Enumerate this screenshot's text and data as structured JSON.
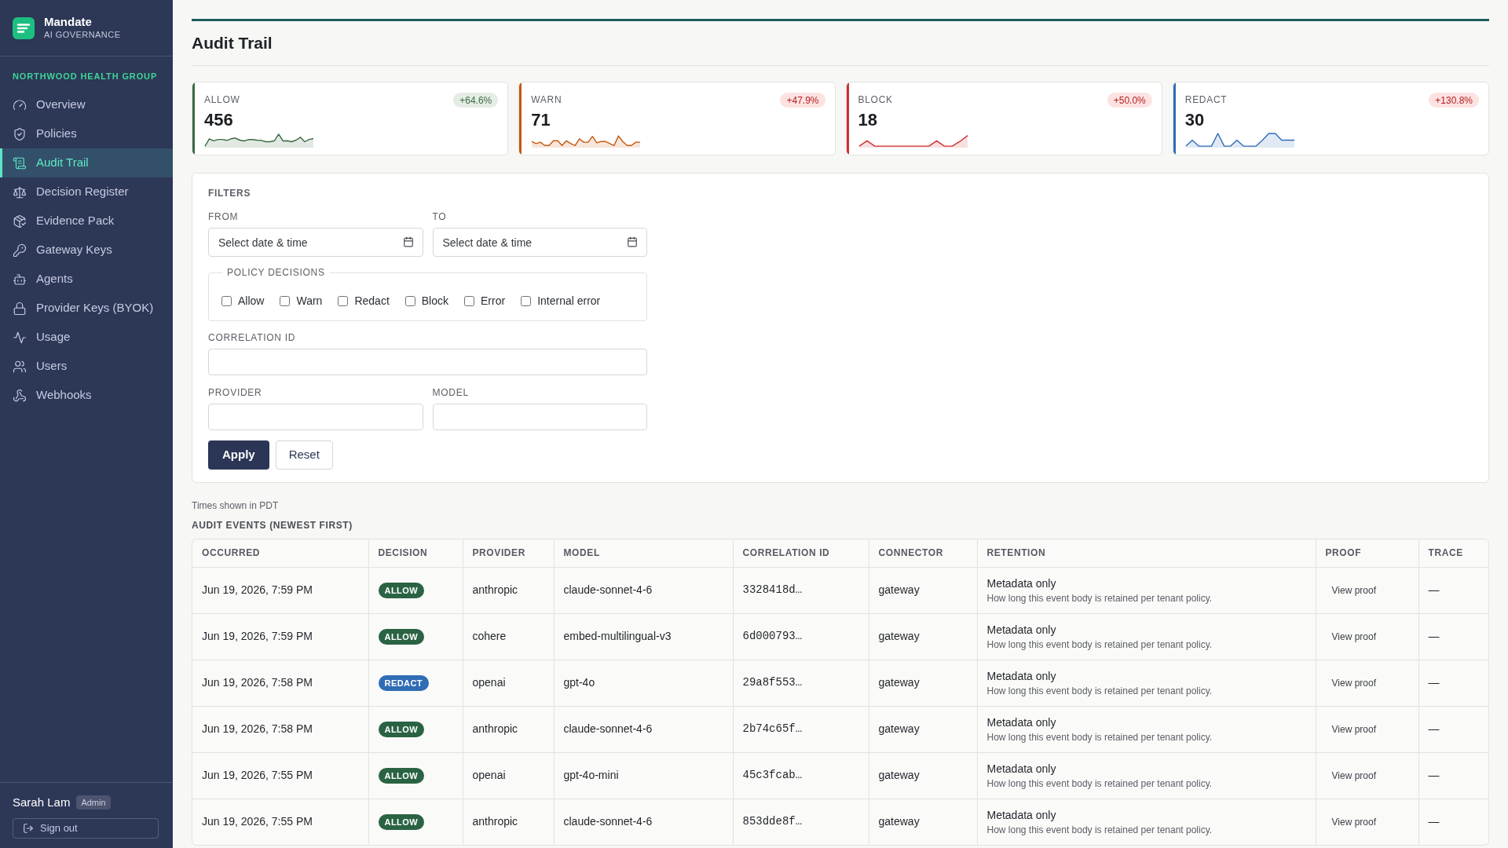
{
  "sidebar": {
    "brand": {
      "name": "Mandate",
      "tagline": "AI GOVERNANCE"
    },
    "org": "NORTHWOOD HEALTH GROUP",
    "items": [
      {
        "label": "Overview",
        "selected": false
      },
      {
        "label": "Policies",
        "selected": false
      },
      {
        "label": "Audit Trail",
        "selected": true
      },
      {
        "label": "Decision Register",
        "selected": false
      },
      {
        "label": "Evidence Pack",
        "selected": false
      },
      {
        "label": "Gateway Keys",
        "selected": false
      },
      {
        "label": "Agents",
        "selected": false
      },
      {
        "label": "Provider Keys (BYOK)",
        "selected": false
      },
      {
        "label": "Usage",
        "selected": false
      },
      {
        "label": "Users",
        "selected": false
      },
      {
        "label": "Webhooks",
        "selected": false
      }
    ],
    "user": {
      "name": "Sarah Lam",
      "role": "Admin"
    },
    "sign_out": "Sign out"
  },
  "header": {
    "title": "Audit Trail"
  },
  "cards": [
    {
      "label": "ALLOW",
      "value": "456",
      "delta": {
        "text": "+64.6%",
        "kind": "good"
      },
      "color": "#3b6a44"
    },
    {
      "label": "WARN",
      "value": "71",
      "delta": {
        "text": "+47.9%",
        "kind": "bad"
      },
      "color": "#c4570f"
    },
    {
      "label": "BLOCK",
      "value": "18",
      "delta": {
        "text": "+50.0%",
        "kind": "bad"
      },
      "color": "#cf2f2f"
    },
    {
      "label": "REDACT",
      "value": "30",
      "delta": {
        "text": "+130.8%",
        "kind": "bad"
      },
      "color": "#2f6cb5"
    }
  ],
  "filters": {
    "title": "FILTERS",
    "from": {
      "label": "FROM",
      "placeholder": "Select date & time"
    },
    "to": {
      "label": "TO",
      "placeholder": "Select date & time"
    },
    "decisions": {
      "legend": "POLICY DECISIONS",
      "options": [
        {
          "label": "Allow",
          "checked": false
        },
        {
          "label": "Warn",
          "checked": false
        },
        {
          "label": "Redact",
          "checked": false
        },
        {
          "label": "Block",
          "checked": false
        },
        {
          "label": "Error",
          "checked": false
        },
        {
          "label": "Internal error",
          "checked": false
        }
      ]
    },
    "correlation_id": {
      "label": "CORRELATION ID"
    },
    "provider": {
      "label": "PROVIDER"
    },
    "model": {
      "label": "MODEL"
    },
    "buttons": {
      "apply": "Apply",
      "reset": "Reset"
    }
  },
  "timezone_note": "Times shown in PDT",
  "table": {
    "title": "AUDIT EVENTS (NEWEST FIRST)",
    "columns": [
      "OCCURRED",
      "DECISION",
      "PROVIDER",
      "MODEL",
      "CORRELATION ID",
      "CONNECTOR",
      "RETENTION",
      "PROOF",
      "TRACE"
    ],
    "rows": [
      {
        "occurred": "Jun 19, 2026, 7:59 PM",
        "decision": {
          "label": "ALLOW",
          "color": "#2a6343"
        },
        "provider": "anthropic",
        "model": "claude-sonnet-4-6",
        "correlation_id": "3328418d…",
        "connector": "gateway",
        "retention": {
          "title": "Metadata only",
          "note": "How long this event body is retained per tenant policy."
        },
        "proof": "View proof",
        "trace": "—"
      },
      {
        "occurred": "Jun 19, 2026, 7:59 PM",
        "decision": {
          "label": "ALLOW",
          "color": "#2a6343"
        },
        "provider": "cohere",
        "model": "embed-multilingual-v3",
        "correlation_id": "6d000793…",
        "connector": "gateway",
        "retention": {
          "title": "Metadata only",
          "note": "How long this event body is retained per tenant policy."
        },
        "proof": "View proof",
        "trace": "—"
      },
      {
        "occurred": "Jun 19, 2026, 7:58 PM",
        "decision": {
          "label": "REDACT",
          "color": "#2f6cb5"
        },
        "provider": "openai",
        "model": "gpt-4o",
        "correlation_id": "29a8f553…",
        "connector": "gateway",
        "retention": {
          "title": "Metadata only",
          "note": "How long this event body is retained per tenant policy."
        },
        "proof": "View proof",
        "trace": "—"
      },
      {
        "occurred": "Jun 19, 2026, 7:58 PM",
        "decision": {
          "label": "ALLOW",
          "color": "#2a6343"
        },
        "provider": "anthropic",
        "model": "claude-sonnet-4-6",
        "correlation_id": "2b74c65f…",
        "connector": "gateway",
        "retention": {
          "title": "Metadata only",
          "note": "How long this event body is retained per tenant policy."
        },
        "proof": "View proof",
        "trace": "—"
      },
      {
        "occurred": "Jun 19, 2026, 7:55 PM",
        "decision": {
          "label": "ALLOW",
          "color": "#2a6343"
        },
        "provider": "openai",
        "model": "gpt-4o-mini",
        "correlation_id": "45c3fcab…",
        "connector": "gateway",
        "retention": {
          "title": "Metadata only",
          "note": "How long this event body is retained per tenant policy."
        },
        "proof": "View proof",
        "trace": "—"
      },
      {
        "occurred": "Jun 19, 2026, 7:55 PM",
        "decision": {
          "label": "ALLOW",
          "color": "#2a6343"
        },
        "provider": "anthropic",
        "model": "claude-sonnet-4-6",
        "correlation_id": "853dde8f…",
        "connector": "gateway",
        "retention": {
          "title": "Metadata only",
          "note": "How long this event body is retained per tenant policy."
        },
        "proof": "View proof",
        "trace": "—"
      }
    ]
  }
}
